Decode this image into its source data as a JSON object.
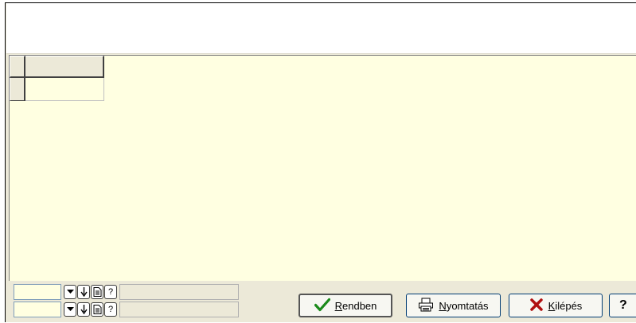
{
  "dialog": {
    "title": ""
  },
  "grid": {
    "column_header": "",
    "row_header": "",
    "cell": ""
  },
  "filters": [
    {
      "value": "",
      "description": ""
    },
    {
      "value": "",
      "description": ""
    }
  ],
  "buttons": {
    "ok_label": "Rendben",
    "print_label": "Nyomtatás",
    "exit_label": "Kilépés",
    "help_label": "?"
  },
  "colors": {
    "dialog_bg": "#ece9d8",
    "grid_bg": "#ffffe1",
    "ok_check": "#1a8a1a",
    "exit_x": "#b01010",
    "button_border": "#003c74"
  },
  "icons": {
    "ok": "checkmark-icon",
    "print": "printer-icon",
    "exit": "x-icon",
    "help": "help-icon"
  }
}
